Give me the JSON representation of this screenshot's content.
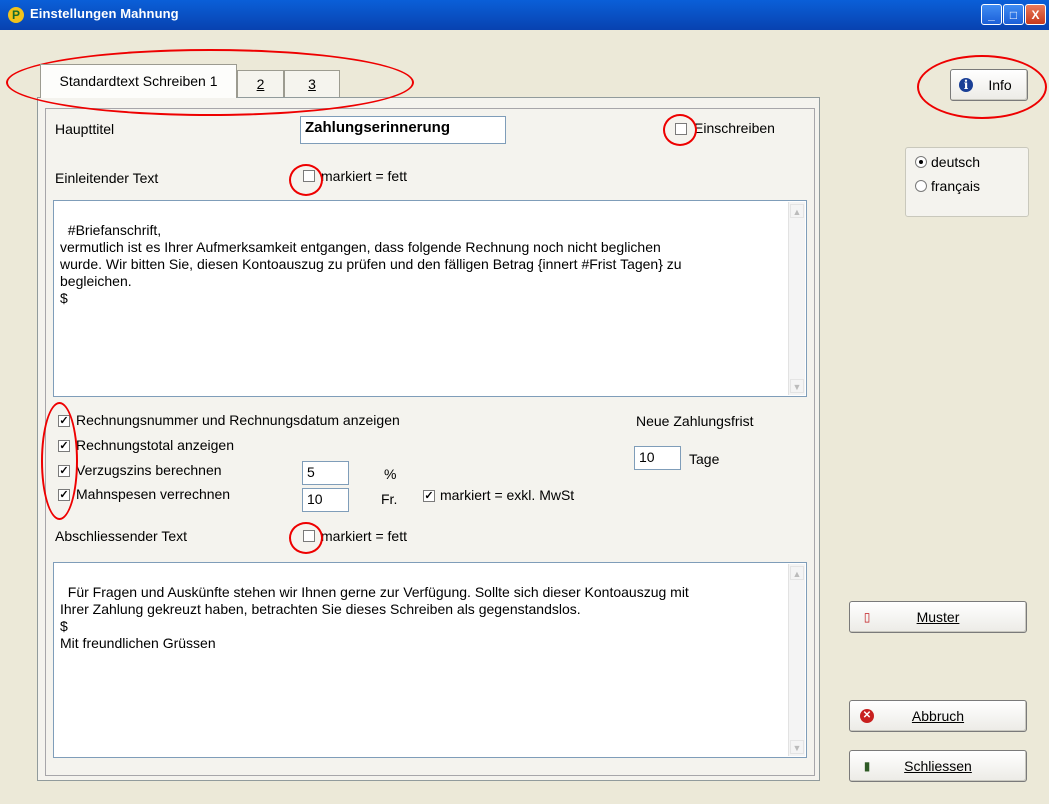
{
  "window": {
    "title": "Einstellungen Mahnung",
    "app_icon_glyph": "P",
    "minimize_glyph": "_",
    "maximize_glyph": "□",
    "close_glyph": "X"
  },
  "tabs": [
    {
      "label": "Standardtext Schreiben 1"
    },
    {
      "label": "2"
    },
    {
      "label": "3"
    }
  ],
  "form": {
    "haupttitel_label": "Haupttitel",
    "haupttitel_value": "Zahlungserinnerung",
    "einschreiben_label": "Einschreiben",
    "einleitender_label": "Einleitender Text",
    "fett_label": "markiert = fett",
    "intro_text": "#Briefanschrift,\nvermutlich ist es Ihrer Aufmerksamkeit entgangen, dass folgende Rechnung noch nicht beglichen\nwurde. Wir bitten Sie, diesen Kontoauszug zu prüfen und den fälligen Betrag {innert #Frist Tagen} zu\nbegleichen.\n$",
    "options": [
      {
        "label": "Rechnungsnummer und Rechnungsdatum anzeigen",
        "checked": true
      },
      {
        "label": "Rechnungstotal anzeigen",
        "checked": true
      },
      {
        "label": "Verzugszins berechnen",
        "checked": true
      },
      {
        "label": "Mahnspesen verrechnen",
        "checked": true
      }
    ],
    "zins_value": "5",
    "zins_unit": "%",
    "spesen_value": "10",
    "spesen_unit": "Fr.",
    "mwst_label": "markiert = exkl. MwSt",
    "frist_label": "Neue Zahlungsfrist",
    "frist_value": "10",
    "frist_unit": "Tage",
    "abschliessender_label": "Abschliessender Text",
    "fett_label2": "markiert = fett",
    "closing_text": "Für Fragen und Auskünfte stehen wir Ihnen gerne zur Verfügung. Sollte sich dieser Kontoauszug mit\nIhrer Zahlung gekreuzt haben, betrachten Sie dieses Schreiben als gegenstandslos.\n$\nMit freundlichen Grüssen"
  },
  "language": {
    "options": [
      {
        "label": "deutsch",
        "selected": true
      },
      {
        "label": "français",
        "selected": false
      }
    ]
  },
  "buttons": {
    "info": "Info",
    "muster": "Muster",
    "abbruch": "Abbruch",
    "schliessen": "Schliessen"
  },
  "colors": {
    "annotation": "#e00000",
    "titlebar": "#0a5fd8"
  }
}
